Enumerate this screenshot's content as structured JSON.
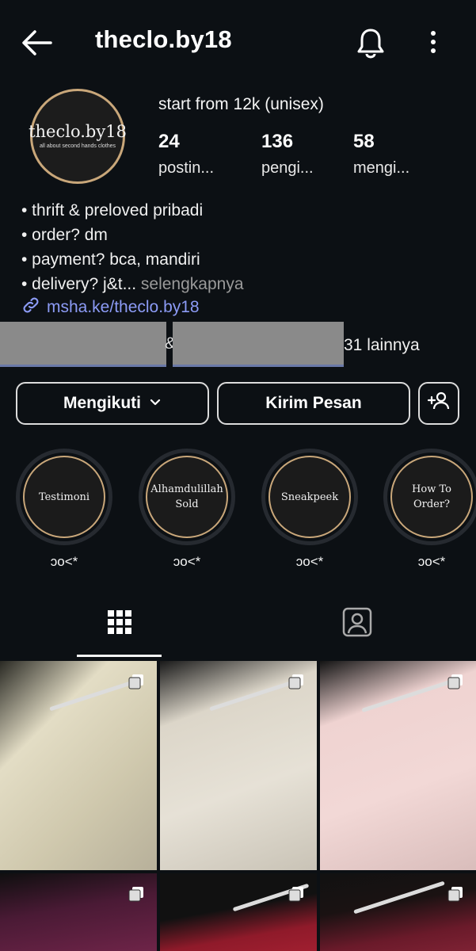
{
  "header": {
    "username": "theclo.by18",
    "icons": [
      "back-arrow-icon",
      "bell-icon",
      "more-vertical-icon"
    ]
  },
  "profile": {
    "avatar_name": "theclo.by18",
    "avatar_tagline": "all about second hands clothes",
    "display_name": "start from 12k (unisex)",
    "stats": [
      {
        "value": "24",
        "label": "postin..."
      },
      {
        "value": "136",
        "label": "pengi..."
      },
      {
        "value": "58",
        "label": "mengi..."
      }
    ]
  },
  "bio": {
    "lines": [
      "• thrift & preloved pribadi",
      "• order? dm",
      "• payment? bca, mandiri"
    ],
    "last_line": "• delivery? j&t...",
    "more_label": " selengkapnya",
    "link": "msha.ke/theclo.by18"
  },
  "followed_by": {
    "separator": "&",
    "others": "31 lainnya"
  },
  "buttons": {
    "follow": "Mengikuti",
    "message": "Kirim Pesan"
  },
  "highlights": [
    {
      "title": "Testimoni",
      "caption": "ↄo<*"
    },
    {
      "title": "Alhamdulillah Sold",
      "caption": "ↄo<*"
    },
    {
      "title": "Sneakpeek",
      "caption": "ↄo<*"
    },
    {
      "title": "How To Order?",
      "caption": "ↄo<*"
    }
  ],
  "tabs": [
    "grid-icon",
    "tagged-icon"
  ],
  "colors": {
    "background": "#0c1014",
    "link": "#8c9bf5",
    "avatar_ring": "#c9a77a"
  }
}
